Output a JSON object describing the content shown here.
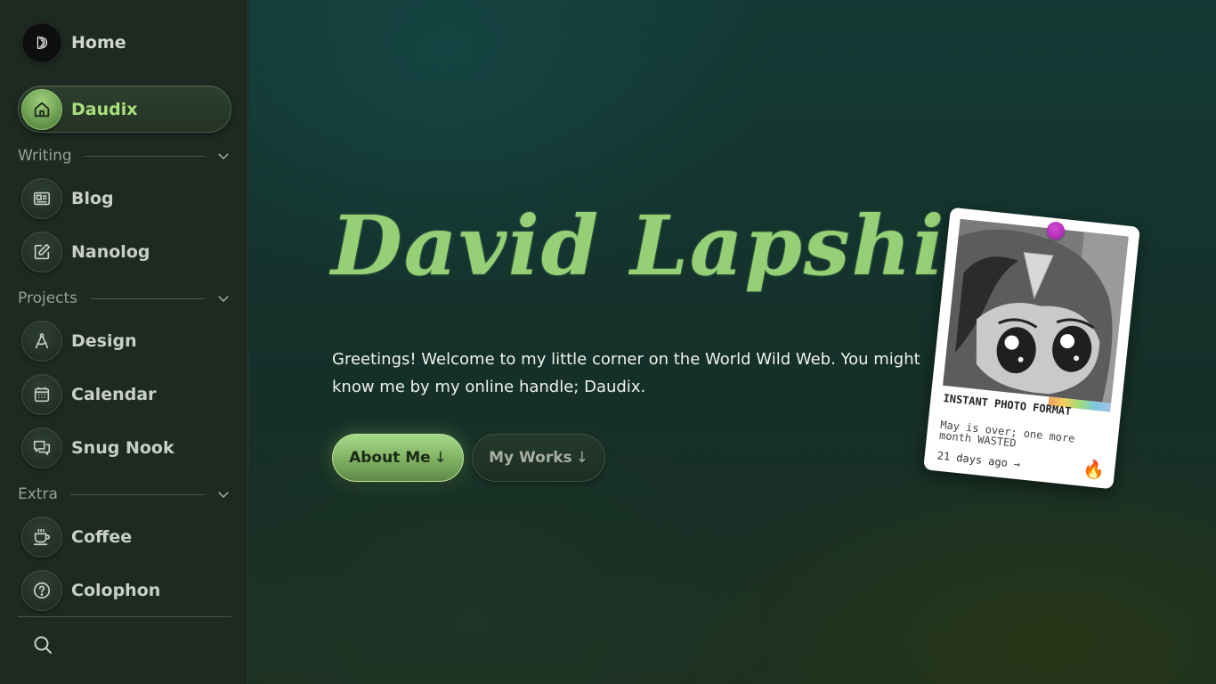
{
  "sidebar": {
    "home_label": "Home",
    "active_label": "Daudix",
    "sections": {
      "writing": "Writing",
      "projects": "Projects",
      "extra": "Extra"
    },
    "items": {
      "blog": "Blog",
      "nanolog": "Nanolog",
      "design": "Design",
      "calendar": "Calendar",
      "snug_nook": "Snug Nook",
      "coffee": "Coffee",
      "colophon": "Colophon"
    },
    "icons": [
      "logo-d-icon",
      "home-icon",
      "newspaper-icon",
      "edit-icon",
      "compass-icon",
      "calendar-icon",
      "chat-bubbles-icon",
      "coffee-cup-icon",
      "question-icon",
      "search-icon",
      "chevron-down-icon"
    ]
  },
  "hero": {
    "title": "David Lapshin",
    "text": "Greetings! Welcome to my little corner on the World Wild Web. You might know me by my online handle; Daudix.",
    "about_button": "About Me",
    "works_button": "My Works",
    "arrow": "↓"
  },
  "polaroid": {
    "title": "INSTANT PHOTO FORMAT",
    "subtitle": "May is over; one more month WASTED",
    "time": "21 days ago →",
    "emoji": "🔥"
  },
  "colors": {
    "accent": "#96d076",
    "sidebar_bg": "#1c2a22",
    "pin": "#b030b8"
  }
}
